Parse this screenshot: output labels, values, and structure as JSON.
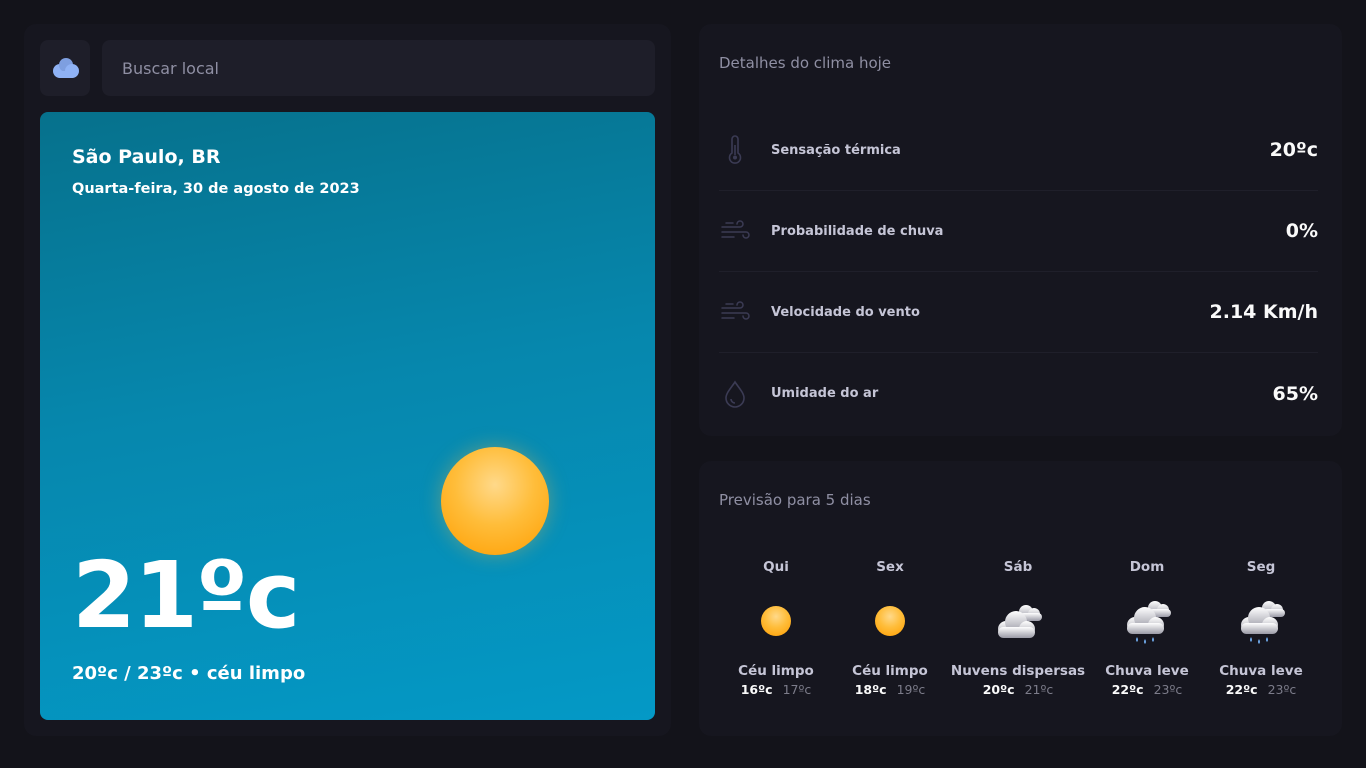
{
  "search": {
    "placeholder": "Buscar local"
  },
  "current": {
    "city": "São Paulo, BR",
    "date": "Quarta-feira, 30 de agosto de 2023",
    "temperature": "21ºc",
    "summary": "20ºc / 23ºc • céu limpo"
  },
  "details": {
    "title": "Detalhes do clima hoje",
    "items": [
      {
        "icon": "thermometer-icon",
        "label": "Sensação térmica",
        "value": "20ºc"
      },
      {
        "icon": "wind-icon",
        "label": "Probabilidade de chuva",
        "value": "0%"
      },
      {
        "icon": "wind-icon",
        "label": "Velocidade do vento",
        "value": "2.14 Km/h"
      },
      {
        "icon": "drop-icon",
        "label": "Umidade do ar",
        "value": "65%"
      }
    ]
  },
  "forecast": {
    "title": "Previsão para 5 dias",
    "days": [
      {
        "day": "Qui",
        "icon": "sun-icon",
        "desc": "Céu limpo",
        "min": "16ºc",
        "max": "17ºc"
      },
      {
        "day": "Sex",
        "icon": "sun-icon",
        "desc": "Céu limpo",
        "min": "18ºc",
        "max": "19ºc"
      },
      {
        "day": "Sáb",
        "icon": "cloud-icon",
        "desc": "Nuvens dispersas",
        "min": "20ºc",
        "max": "21ºc"
      },
      {
        "day": "Dom",
        "icon": "rain-cloud-icon",
        "desc": "Chuva leve",
        "min": "22ºc",
        "max": "23ºc"
      },
      {
        "day": "Seg",
        "icon": "rain-cloud-icon",
        "desc": "Chuva leve",
        "min": "22ºc",
        "max": "23ºc"
      }
    ]
  },
  "colors": {
    "background": "#13131a",
    "panel": "#16161f",
    "accent": "#8fb2f5",
    "sun": "#ffa800"
  }
}
